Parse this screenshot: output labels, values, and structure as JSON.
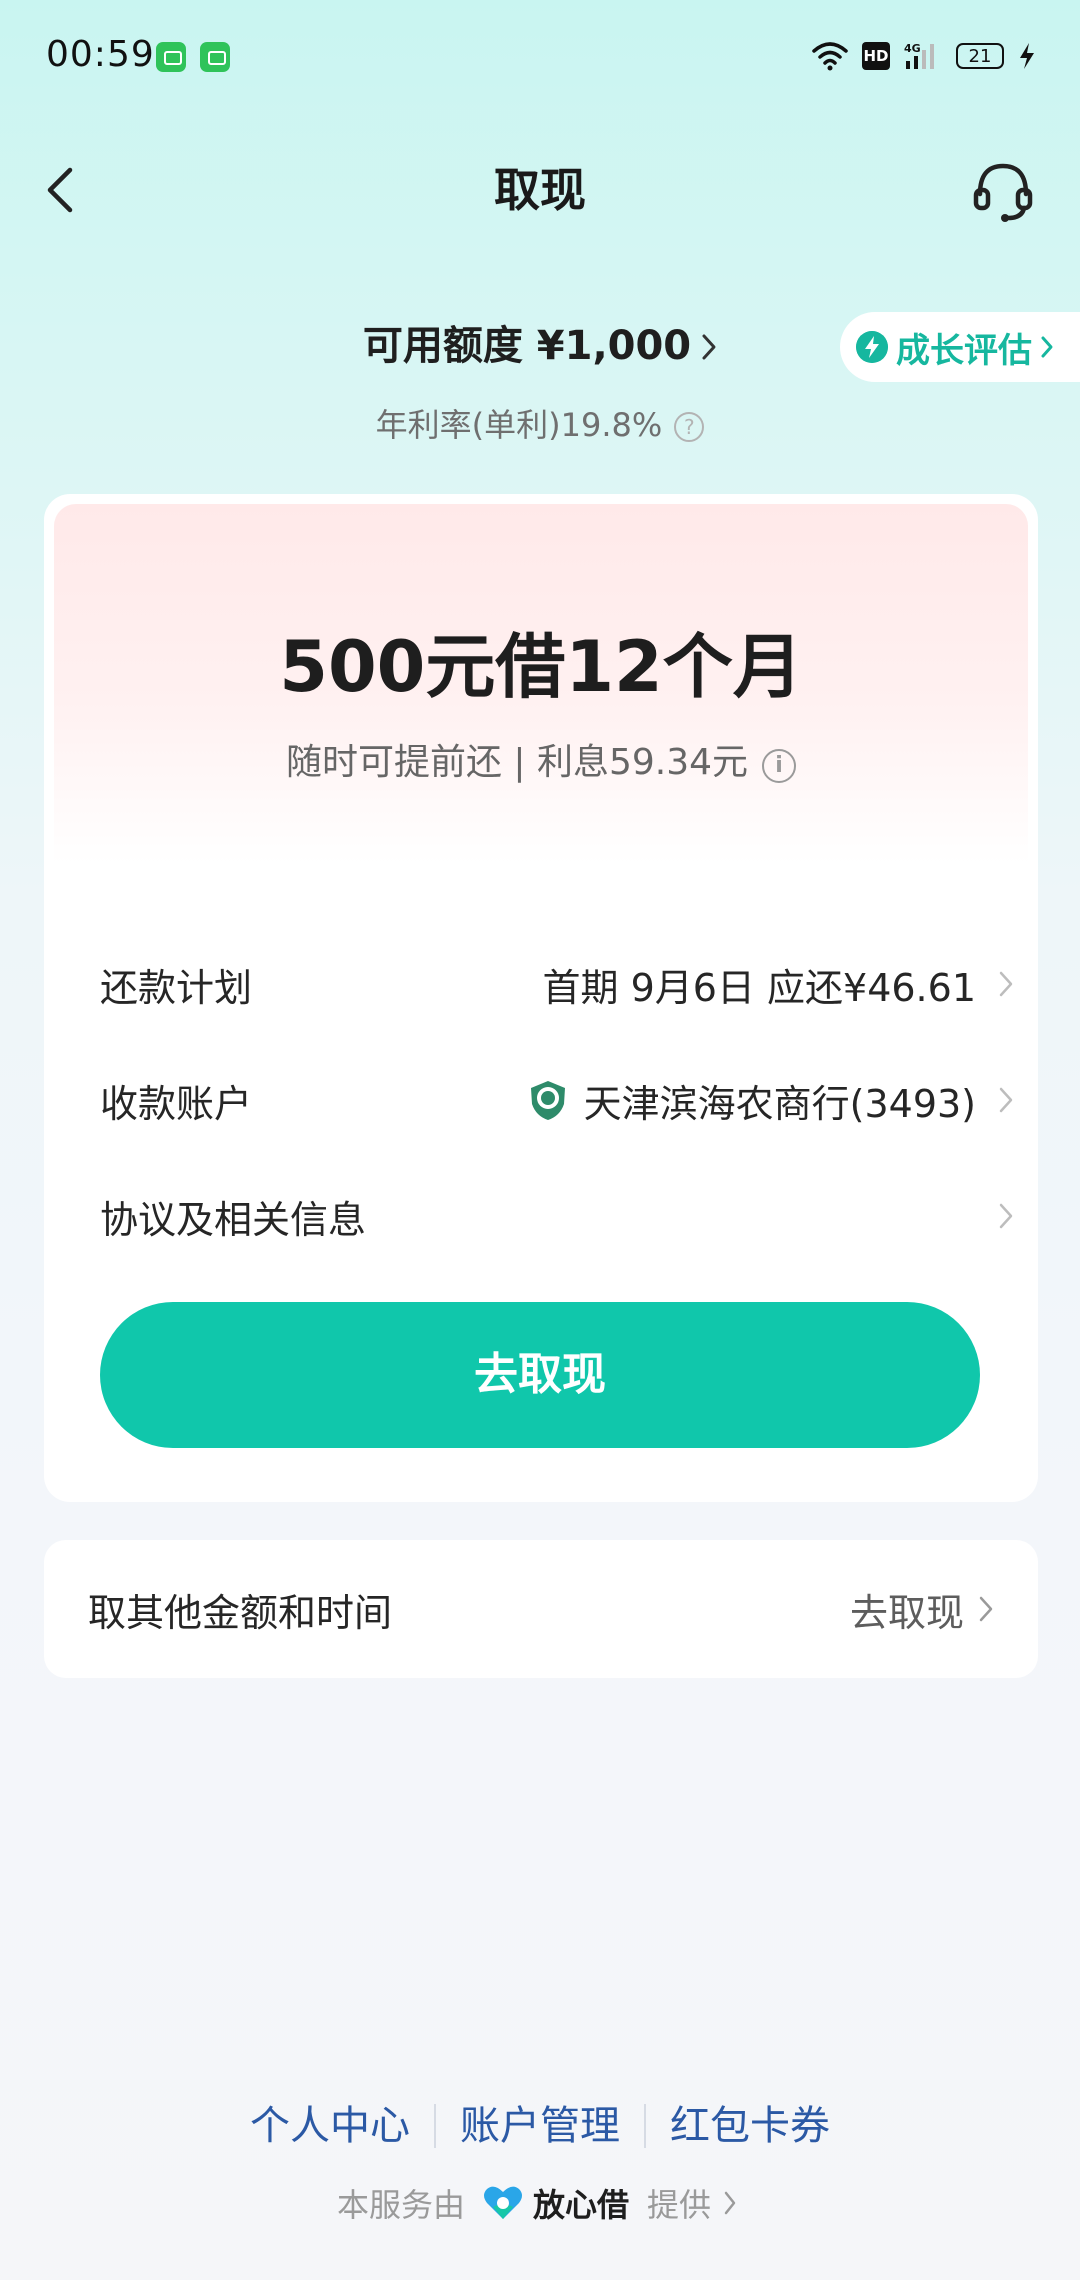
{
  "status_bar": {
    "time": "00:59",
    "hd": "HD",
    "network": "4G",
    "battery": "21"
  },
  "nav": {
    "title": "取现"
  },
  "credit": {
    "label": "可用额度 ¥1,000",
    "growth_label": "成长评估",
    "rate_label": "年利率(单利)19.8%",
    "help_glyph": "?"
  },
  "loan": {
    "title": "500元借12个月",
    "subtitle": "随时可提前还 | 利息59.34元",
    "info_glyph": "i"
  },
  "rows": {
    "repay_label": "还款计划",
    "repay_value": "首期 9月6日 应还¥46.61",
    "account_label": "收款账户",
    "account_value": "天津滨海农商行(3493)",
    "agreement_label": "协议及相关信息"
  },
  "primary_button": {
    "label": "去取现"
  },
  "other_amount": {
    "label": "取其他金额和时间",
    "action": "去取现"
  },
  "footer": {
    "links": [
      "个人中心",
      "账户管理",
      "红包卡券"
    ],
    "provider_prefix": "本服务由",
    "provider_brand": "放心借",
    "provider_suffix": "提供"
  },
  "colors": {
    "accent": "#10c7ab",
    "growth": "#16b79f",
    "link": "#2b59a5"
  },
  "icons": [
    "back-arrow-icon",
    "headset-icon",
    "growth-bolt-icon",
    "help-icon",
    "info-icon",
    "chevron-right-icon",
    "bank-logo-icon",
    "brand-logo-icon"
  ]
}
